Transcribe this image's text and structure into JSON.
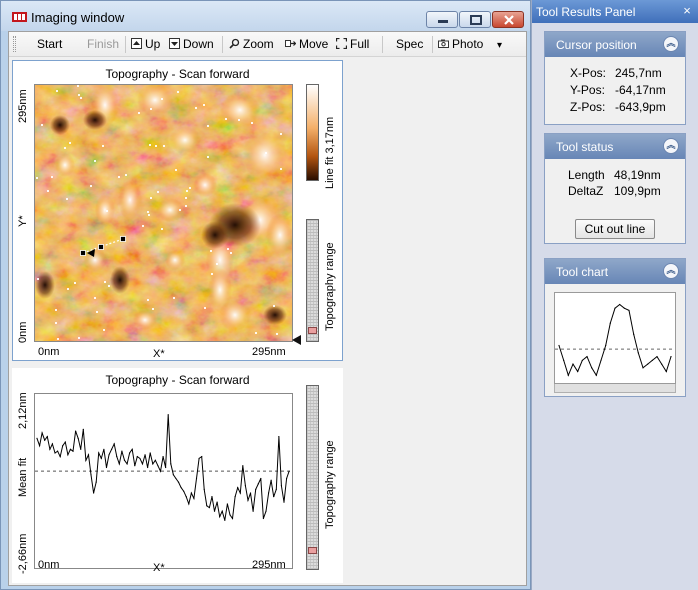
{
  "window": {
    "title": "Imaging window",
    "controls": [
      "minimize",
      "maximize",
      "close"
    ]
  },
  "toolbar": {
    "start": "Start",
    "finish": "Finish",
    "up": "Up",
    "down": "Down",
    "zoom": "Zoom",
    "move": "Move",
    "full": "Full",
    "spec": "Spec",
    "photo": "Photo",
    "overflow": "▾"
  },
  "topography_panel": {
    "title": "Topography - Scan forward",
    "y_axis_label": "Y*",
    "y_tick_top": "295nm",
    "y_tick_bottom": "0nm",
    "x_axis_label": "X*",
    "x_tick_left": "0nm",
    "x_tick_right": "295nm",
    "colorbar_label": "Line fit 3,17nm",
    "range_label": "Topography range",
    "range_thumb_fraction": 0.08
  },
  "profile_panel": {
    "title": "Topography - Scan forward",
    "y_tick_top": "2,12nm",
    "y_axis_label": "Mean fit",
    "y_tick_bottom": "-2,66nm",
    "x_axis_label": "X*",
    "x_tick_left": "0nm",
    "x_tick_right": "295nm",
    "range_label": "Topography range",
    "range_thumb_fraction": 0.1,
    "chart_data": {
      "type": "line",
      "xlabel": "X*",
      "ylabel": "Mean fit",
      "xlim": [
        0,
        295
      ],
      "ylim": [
        -2.66,
        2.12
      ],
      "mean_line": 0,
      "x": [
        0,
        3,
        6,
        9,
        12,
        15,
        18,
        21,
        24,
        27,
        30,
        33,
        36,
        39,
        42,
        45,
        48,
        51,
        54,
        57,
        60,
        63,
        66,
        69,
        72,
        75,
        78,
        81,
        84,
        87,
        90,
        93,
        96,
        99,
        102,
        105,
        108,
        111,
        114,
        117,
        120,
        123,
        126,
        129,
        132,
        135,
        138,
        141,
        144,
        147,
        150,
        153,
        156,
        159,
        162,
        165,
        168,
        171,
        174,
        177,
        180,
        183,
        186,
        189,
        192,
        195,
        198,
        201,
        204,
        207,
        210,
        213,
        216,
        219,
        222,
        225,
        228,
        231,
        234,
        237,
        240,
        243,
        246,
        249,
        252,
        255,
        258,
        261,
        264,
        267,
        270,
        273,
        276,
        279,
        282,
        285,
        288,
        291,
        294
      ],
      "y": [
        0.9,
        0.7,
        1.05,
        0.85,
        0.95,
        0.6,
        0.75,
        0.5,
        0.55,
        0.4,
        0.7,
        0.8,
        0.45,
        0.6,
        0.55,
        1.1,
        0.9,
        0.6,
        1.15,
        0.3,
        0.45,
        -0.1,
        -0.6,
        -0.3,
        0.5,
        0.35,
        0.6,
        0.1,
        0.45,
        0.6,
        0.75,
        0.4,
        0.2,
        0.55,
        0.3,
        0.2,
        0.5,
        0.6,
        0.15,
        0.4,
        0.35,
        0.2,
        0.45,
        0.1,
        0.5,
        0.2,
        0.3,
        0.15,
        0.0,
        0.4,
        0.1,
        1.55,
        0.2,
        -0.1,
        -0.2,
        -0.3,
        -0.45,
        -0.55,
        -0.7,
        -0.9,
        -0.6,
        -0.75,
        -0.2,
        0.35,
        0.4,
        -0.5,
        -0.95,
        -1.0,
        -0.7,
        -1.1,
        -0.85,
        -1.25,
        -1.1,
        -1.35,
        -0.9,
        -1.2,
        -1.3,
        -0.7,
        -0.45,
        -0.6,
        0.15,
        -0.4,
        -0.8,
        -0.6,
        -1.1,
        -0.5,
        -0.35,
        -0.2,
        -1.3,
        -1.1,
        -0.6,
        -0.25,
        -0.7,
        -0.5,
        0.95,
        -0.4,
        -0.85,
        -0.2,
        0.0
      ]
    }
  },
  "tool_results_panel": {
    "title": "Tool Results Panel",
    "close_glyph": "×",
    "cursor_position": {
      "header": "Cursor position",
      "rows": [
        {
          "label": "X-Pos:",
          "value": "245,7nm"
        },
        {
          "label": "Y-Pos:",
          "value": "-64,17nm"
        },
        {
          "label": "Z-Pos:",
          "value": "-643,9pm"
        }
      ]
    },
    "tool_status": {
      "header": "Tool status",
      "rows": [
        {
          "label": "Length",
          "value": "48,19nm"
        },
        {
          "label": "DeltaZ",
          "value": "109,9pm"
        }
      ],
      "button": "Cut out line"
    },
    "tool_chart": {
      "header": "Tool chart",
      "chart_data": {
        "type": "line",
        "x": [
          0,
          1,
          2,
          3,
          4,
          5,
          6,
          7,
          8,
          9,
          10,
          11,
          12,
          13,
          14,
          15,
          16,
          17,
          18,
          19,
          20,
          21,
          22,
          23,
          24
        ],
        "y": [
          0.45,
          0.25,
          0.05,
          0.2,
          0.1,
          0.25,
          0.3,
          0.15,
          0.05,
          0.25,
          0.45,
          0.75,
          0.95,
          1.0,
          0.95,
          0.92,
          0.6,
          0.35,
          0.15,
          0.2,
          0.25,
          0.3,
          0.2,
          0.1,
          0.3
        ],
        "mean_line": 0.4,
        "ylim": [
          0,
          1.1
        ]
      }
    },
    "collapse_glyph": "︽"
  }
}
